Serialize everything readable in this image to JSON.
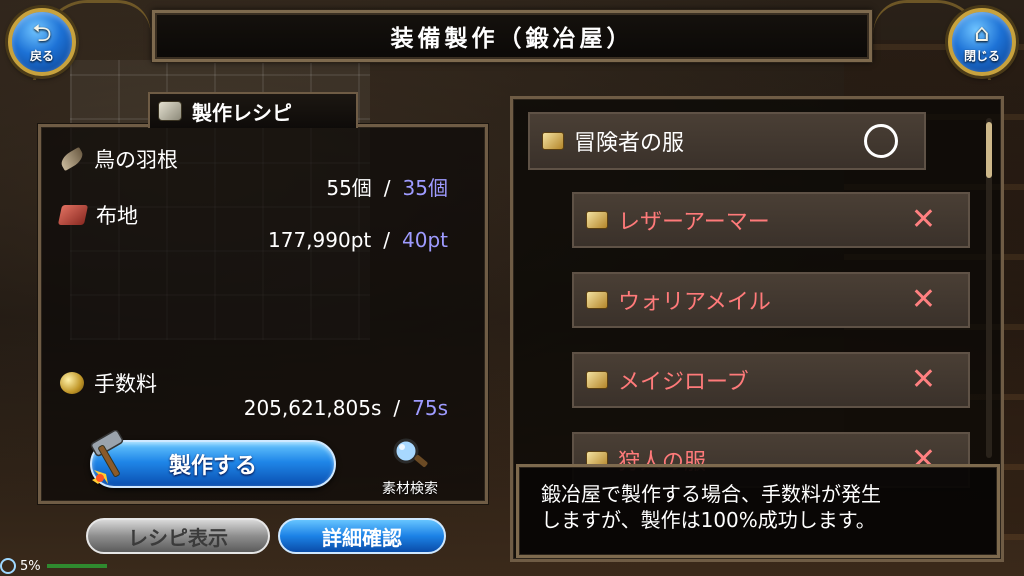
{
  "title": "装備製作（鍛冶屋）",
  "nav": {
    "back_label": "戻る",
    "close_label": "閉じる",
    "back_glyph": "⮌",
    "close_glyph": "⌂"
  },
  "recipe": {
    "tab_label": "製作レシピ",
    "materials": [
      {
        "name": "鳥の羽根",
        "have": "55個",
        "need": "35個",
        "icon": "feather-icon"
      },
      {
        "name": "布地",
        "have": "177,990pt",
        "need": "40pt",
        "icon": "cloth-icon"
      }
    ],
    "fee": {
      "label": "手数料",
      "have": "205,621,805s",
      "need": "75s",
      "icon": "coin-icon"
    },
    "separator": "/"
  },
  "buttons": {
    "craft": "製作する",
    "material_search": "素材検索",
    "recipe_view": "レシピ表示",
    "detail": "詳細確認"
  },
  "item_list": {
    "main": {
      "name": "冒険者の服",
      "mark": "circle"
    },
    "subs": [
      {
        "name": "レザーアーマー",
        "mark": "✕"
      },
      {
        "name": "ウォリアメイル",
        "mark": "✕"
      },
      {
        "name": "メイジローブ",
        "mark": "✕"
      },
      {
        "name": "狩人の服",
        "mark": "✕"
      }
    ]
  },
  "info_text_line1": "鍛冶屋で製作する場合、手数料が発生",
  "info_text_line2": "しますが、製作は100%成功します。",
  "status": {
    "percent": "5%"
  },
  "colors": {
    "need_value": "#9e9bff",
    "unavailable_item": "#ff7a7a",
    "primary_button": "#1f86e8"
  }
}
